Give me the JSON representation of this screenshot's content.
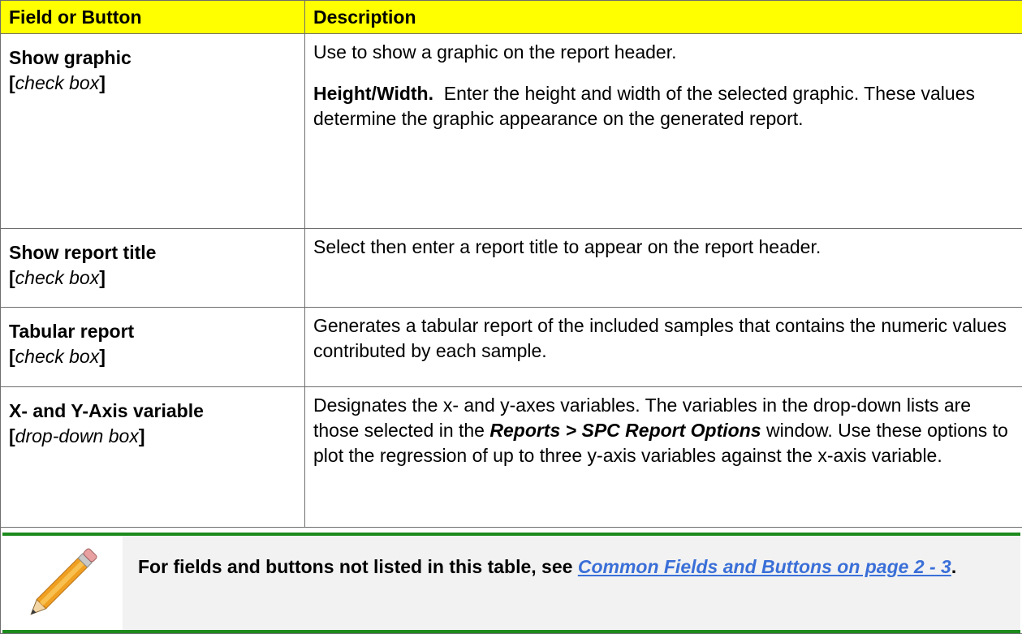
{
  "table": {
    "headers": [
      "Field or Button",
      "Description"
    ],
    "rows": [
      {
        "field_name": "Show graphic",
        "field_type": "check box",
        "description_1": "Use to show a graphic on the report header.",
        "sub_label": "Height/Width.",
        "sub_text": "Enter the height and width of the selected graphic. These values determine the graphic appearance on the generated report."
      },
      {
        "field_name": "Show report title",
        "field_type": "check box",
        "description": "Select then enter a report title to appear on the report header."
      },
      {
        "field_name": "Tabular report",
        "field_type": "check box",
        "description": "Generates a tabular report of the included samples that contains the numeric values contributed by each sample."
      },
      {
        "field_name": "X- and Y-Axis variable",
        "field_type": "drop-down box",
        "description_pre": "Designates the x- and y-axes variables. The variables in the drop-down lists are those selected in the",
        "menu_path": "Reports > SPC Report Options",
        "description_post": "window. Use these options to plot the regression of up to three y-axis variables against the x-axis variable."
      }
    ]
  },
  "note": {
    "icon": "pencil-icon",
    "text_pre": "For fields and buttons not listed in this table, see",
    "link_text": "Common Fields and Buttons on page 2 - 3",
    "text_post": ".",
    "colors": {
      "border": "#1c8a1c",
      "background": "#f2f2f2",
      "link": "#3a6fd8",
      "header": "#ffff00"
    }
  }
}
